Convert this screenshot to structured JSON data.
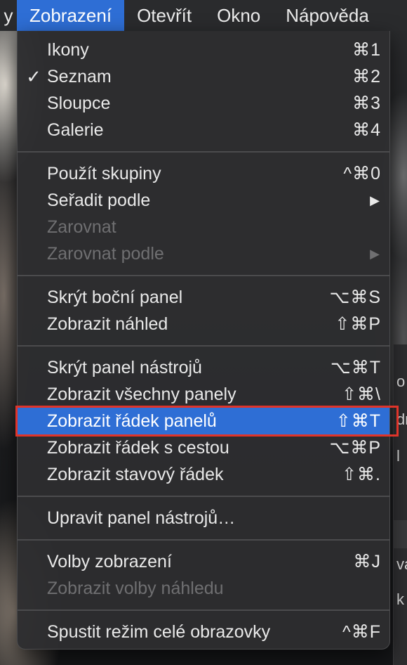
{
  "menubar": {
    "partial_left": "y",
    "items": [
      "Zobrazení",
      "Otevřít",
      "Okno",
      "Nápověda"
    ],
    "active_index": 0
  },
  "menu": {
    "groups": [
      [
        {
          "label": "Ikony",
          "shortcut": "⌘1",
          "checked": false,
          "disabled": false
        },
        {
          "label": "Seznam",
          "shortcut": "⌘2",
          "checked": true,
          "disabled": false
        },
        {
          "label": "Sloupce",
          "shortcut": "⌘3",
          "checked": false,
          "disabled": false
        },
        {
          "label": "Galerie",
          "shortcut": "⌘4",
          "checked": false,
          "disabled": false
        }
      ],
      [
        {
          "label": "Použít skupiny",
          "shortcut": "^⌘0",
          "checked": false,
          "disabled": false
        },
        {
          "label": "Seřadit podle",
          "shortcut": "",
          "submenu": true,
          "disabled": false
        },
        {
          "label": "Zarovnat",
          "shortcut": "",
          "disabled": true
        },
        {
          "label": "Zarovnat podle",
          "shortcut": "",
          "submenu": true,
          "disabled": true
        }
      ],
      [
        {
          "label": "Skrýt boční panel",
          "shortcut": "⌥⌘S",
          "disabled": false
        },
        {
          "label": "Zobrazit náhled",
          "shortcut": "⇧⌘P",
          "disabled": false
        }
      ],
      [
        {
          "label": "Skrýt panel nástrojů",
          "shortcut": "⌥⌘T",
          "disabled": false
        },
        {
          "label": "Zobrazit všechny panely",
          "shortcut": "⇧⌘\\",
          "disabled": false
        },
        {
          "label": "Zobrazit řádek panelů",
          "shortcut": "⇧⌘T",
          "disabled": false,
          "highlighted": true
        },
        {
          "label": "Zobrazit řádek s cestou",
          "shortcut": "⌥⌘P",
          "disabled": false
        },
        {
          "label": "Zobrazit stavový řádek",
          "shortcut": "⇧⌘.",
          "disabled": false
        }
      ],
      [
        {
          "label": "Upravit panel nástrojů…",
          "shortcut": "",
          "disabled": false
        }
      ],
      [
        {
          "label": "Volby zobrazení",
          "shortcut": "⌘J",
          "disabled": false
        },
        {
          "label": "Zobrazit volby náhledu",
          "shortcut": "",
          "disabled": true
        }
      ],
      [
        {
          "label": "Spustit režim celé obrazovky",
          "shortcut": "^⌘F",
          "disabled": false
        }
      ]
    ]
  },
  "submenu_arrow": "▶",
  "checkmark": "✓",
  "finder_fragments": [
    "o",
    "dr",
    "l",
    "",
    "",
    "va",
    "k"
  ],
  "colors": {
    "accent": "#2e6ed5",
    "callout": "#e0342a",
    "menu_bg": "#2d2d2f",
    "disabled_text": "#6f6f71"
  }
}
